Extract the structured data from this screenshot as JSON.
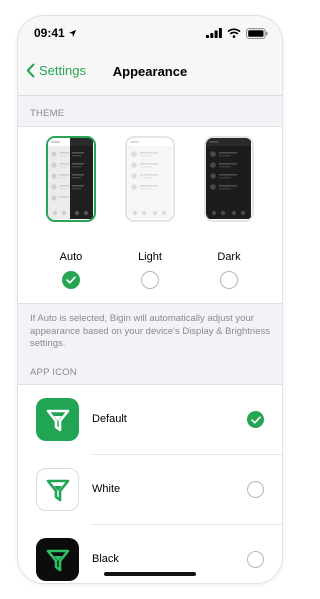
{
  "status_bar": {
    "time": "09:41"
  },
  "nav": {
    "back_label": "Settings",
    "title": "Appearance"
  },
  "theme": {
    "header": "THEME",
    "options": [
      {
        "label": "Auto",
        "selected": true
      },
      {
        "label": "Light",
        "selected": false
      },
      {
        "label": "Dark",
        "selected": false
      }
    ],
    "note": "If Auto is selected, Bigin will automatically adjust your appearance based on your device's Display & Brightness settings."
  },
  "app_icon": {
    "header": "APP ICON",
    "options": [
      {
        "label": "Default",
        "selected": true
      },
      {
        "label": "White",
        "selected": false
      },
      {
        "label": "Black",
        "selected": false
      }
    ]
  },
  "colors": {
    "accent": "#26a552"
  }
}
